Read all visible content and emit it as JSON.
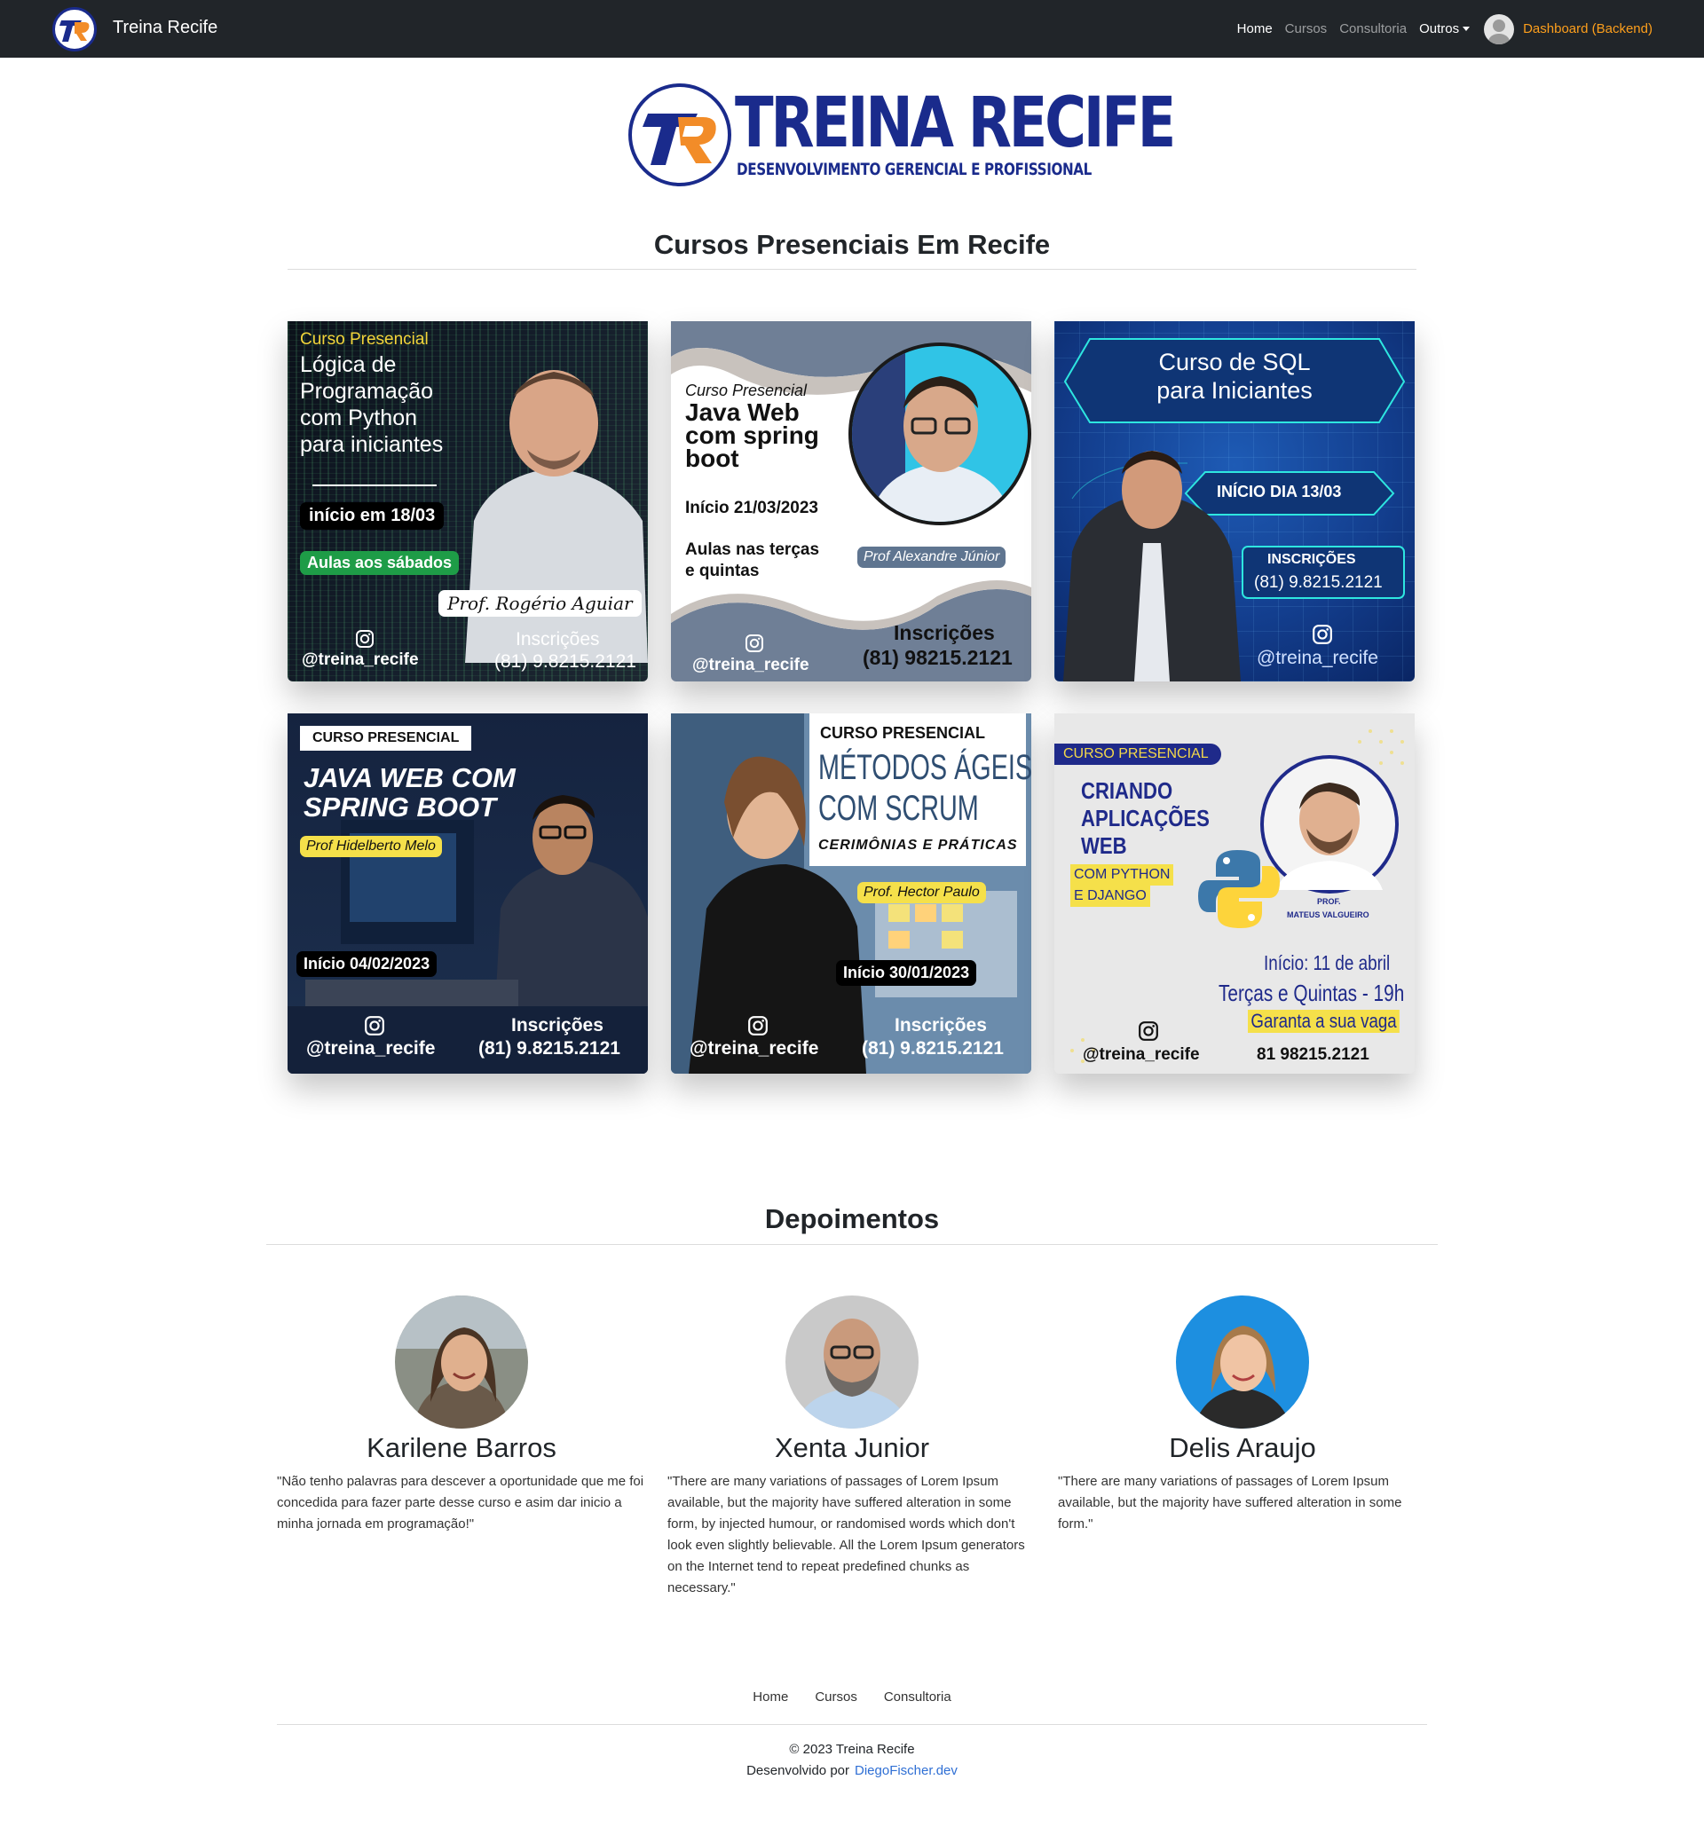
{
  "navbar": {
    "brand": "Treina Recife",
    "links": [
      "Home",
      "Cursos",
      "Consultoria"
    ],
    "dropdown": "Outros",
    "dashboard": "Dashboard (Backend)"
  },
  "hero": {
    "title": "TREINA RECIFE",
    "subtitle": "DESENVOLVIMENTO GERENCIAL E PROFISSIONAL"
  },
  "courses_heading": "Cursos Presenciais Em Recife",
  "courses": [
    {
      "tag": "Curso Presencial",
      "title_lines": [
        "Lógica de",
        "Programação",
        "com Python",
        "para iniciantes"
      ],
      "start": "início em 18/03",
      "schedule": "Aulas aos sábados",
      "teacher": "Prof. Rogério Aguiar",
      "instagram": "@treina_recife",
      "signup_label": "Inscrições",
      "phone": "(81) 9.8215.2121"
    },
    {
      "tag": "Curso Presencial",
      "title_lines": [
        "Java Web",
        "com spring",
        "boot"
      ],
      "start": "Início 21/03/2023",
      "schedule_lines": [
        "Aulas nas terças",
        "e quintas"
      ],
      "teacher": "Prof Alexandre Júnior",
      "instagram": "@treina_recife",
      "signup_label": "Inscrições",
      "phone": "(81) 98215.2121"
    },
    {
      "title_lines": [
        "Curso de SQL",
        "para Iniciantes"
      ],
      "start": "INÍCIO DIA 13/03",
      "signup_label": "INSCRIÇÕES",
      "phone": "(81) 9.8215.2121",
      "instagram": "@treina_recife"
    },
    {
      "tag": "CURSO PRESENCIAL",
      "title_lines": [
        "JAVA WEB COM",
        "SPRING BOOT"
      ],
      "teacher": "Prof Hidelberto Melo",
      "start": "Início 04/02/2023",
      "instagram": "@treina_recife",
      "signup_label": "Inscrições",
      "phone": "(81) 9.8215.2121"
    },
    {
      "tag": "CURSO PRESENCIAL",
      "title_lines": [
        "MÉTODOS ÁGEIS",
        "COM SCRUM"
      ],
      "subtitle": "CERIMÔNIAS E PRÁTICAS",
      "teacher": "Prof. Hector Paulo",
      "start": "Início 30/01/2023",
      "instagram": "@treina_recife",
      "signup_label": "Inscrições",
      "phone": "(81) 9.8215.2121"
    },
    {
      "tag": "CURSO PRESENCIAL",
      "title_lines": [
        "CRIANDO",
        "APLICAÇÕES",
        "WEB"
      ],
      "tech_lines": [
        "COM PYTHON",
        "E DJANGO"
      ],
      "teacher_prefix": "PROF.",
      "teacher": "MATEUS VALGUEIRO",
      "start": "Início:  11 de abril",
      "schedule": "Terças e Quintas - 19h",
      "cta": "Garanta a sua vaga",
      "instagram": "@treina_recife",
      "phone": "81 98215.2121"
    }
  ],
  "testimonials_heading": "Depoimentos",
  "testimonials": [
    {
      "name": "Karilene Barros",
      "text": "\"Não tenho palavras para descever a oportunidade que me foi concedida para fazer parte desse curso e asim dar inicio a minha jornada em programação!\""
    },
    {
      "name": "Xenta Junior",
      "text": "\"There are many variations of passages of Lorem Ipsum available, but the majority have suffered alteration in some form, by injected humour, or randomised words which don't look even slightly believable. All the Lorem Ipsum generators on the Internet tend to repeat predefined chunks as necessary.\""
    },
    {
      "name": "Delis Araujo",
      "text": "\"There are many variations of passages of Lorem Ipsum available, but the majority have suffered alteration in some form.\""
    }
  ],
  "footer": {
    "links": [
      "Home",
      "Cursos",
      "Consultoria"
    ],
    "copyright": "© 2023 Treina Recife",
    "dev_prefix": "Desenvolvido por",
    "dev_link": "DiegoFischer.dev"
  },
  "colors": {
    "navbar_bg": "#212529",
    "dashboard_link": "#fd9f1c",
    "brand_blue": "#1a2b8c",
    "brand_orange": "#f28c28",
    "footer_link": "#2f6fd4"
  },
  "icons": [
    "user-avatar-icon",
    "instagram-icon",
    "python-logo-icon"
  ]
}
